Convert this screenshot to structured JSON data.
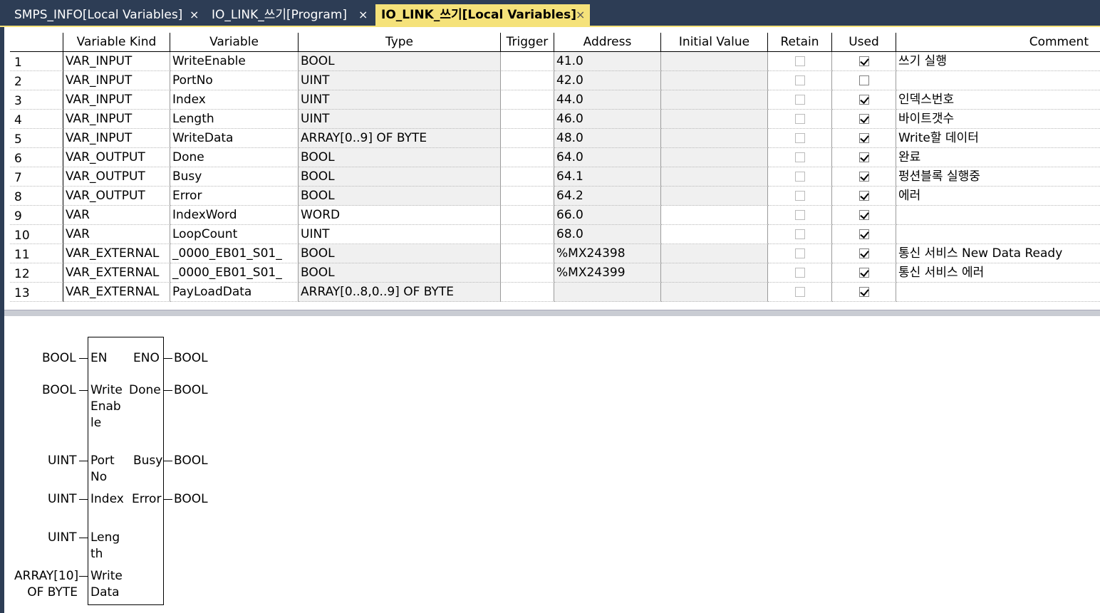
{
  "tabs": [
    {
      "label": "SMPS_INFO[Local Variables]",
      "close": "×",
      "active": false
    },
    {
      "label": "IO_LINK_쓰기[Program]",
      "close": "×",
      "active": false
    },
    {
      "label": "IO_LINK_쓰기[Local Variables]",
      "close": "×",
      "active": true
    }
  ],
  "grid": {
    "columns": [
      "Variable Kind",
      "Variable",
      "Type",
      "Trigger",
      "Address",
      "Initial Value",
      "Retain",
      "Used",
      "Comment"
    ],
    "rows": [
      {
        "num": "1",
        "kind": "VAR_INPUT",
        "var": "WriteEnable",
        "type": "BOOL",
        "trigger": "",
        "address": "41.0",
        "init": "",
        "retain": false,
        "used": true,
        "comment": "쓰기 실행"
      },
      {
        "num": "2",
        "kind": "VAR_INPUT",
        "var": "PortNo",
        "type": "UINT",
        "trigger": "",
        "address": "42.0",
        "init": "",
        "retain": false,
        "used": false,
        "comment": ""
      },
      {
        "num": "3",
        "kind": "VAR_INPUT",
        "var": "Index",
        "type": "UINT",
        "trigger": "",
        "address": "44.0",
        "init": "",
        "retain": false,
        "used": true,
        "comment": "인덱스번호"
      },
      {
        "num": "4",
        "kind": "VAR_INPUT",
        "var": "Length",
        "type": "UINT",
        "trigger": "",
        "address": "46.0",
        "init": "",
        "retain": false,
        "used": true,
        "comment": "바이트갯수"
      },
      {
        "num": "5",
        "kind": "VAR_INPUT",
        "var": "WriteData",
        "type": "ARRAY[0..9] OF BYTE",
        "trigger": "",
        "address": "48.0",
        "init": "",
        "retain": false,
        "used": true,
        "comment": "Write할 데이터"
      },
      {
        "num": "6",
        "kind": "VAR_OUTPUT",
        "var": "Done",
        "type": "BOOL",
        "trigger": "",
        "address": "64.0",
        "init": "",
        "retain": false,
        "used": true,
        "comment": "완료"
      },
      {
        "num": "7",
        "kind": "VAR_OUTPUT",
        "var": "Busy",
        "type": "BOOL",
        "trigger": "",
        "address": "64.1",
        "init": "",
        "retain": false,
        "used": true,
        "comment": "펑션블록 실행중"
      },
      {
        "num": "8",
        "kind": "VAR_OUTPUT",
        "var": "Error",
        "type": "BOOL",
        "trigger": "",
        "address": "64.2",
        "init": "",
        "retain": false,
        "used": true,
        "comment": "에러"
      },
      {
        "num": "9",
        "kind": "VAR",
        "var": "IndexWord",
        "type": "WORD",
        "trigger": "",
        "address": "66.0",
        "init": "",
        "retain": false,
        "used": true,
        "comment": ""
      },
      {
        "num": "10",
        "kind": "VAR",
        "var": "LoopCount",
        "type": "UINT",
        "trigger": "",
        "address": "68.0",
        "init": "",
        "retain": false,
        "used": true,
        "comment": ""
      },
      {
        "num": "11",
        "kind": "VAR_EXTERNAL",
        "var": "_0000_EB01_S01_",
        "type": "BOOL",
        "trigger": "",
        "address": "%MX24398",
        "init": "",
        "retain": false,
        "used": true,
        "comment": "통신 서비스 New Data Ready"
      },
      {
        "num": "12",
        "kind": "VAR_EXTERNAL",
        "var": "_0000_EB01_S01_",
        "type": "BOOL",
        "trigger": "",
        "address": "%MX24399",
        "init": "",
        "retain": false,
        "used": true,
        "comment": "통신 서비스 에러"
      },
      {
        "num": "13",
        "kind": "VAR_EXTERNAL",
        "var": "PayLoadData",
        "type": "ARRAY[0..8,0..9] OF BYTE",
        "trigger": "",
        "address": "",
        "init": "",
        "retain": false,
        "used": true,
        "comment": ""
      }
    ]
  },
  "function_block": {
    "inputs": [
      {
        "type": "BOOL",
        "name": "EN"
      },
      {
        "type": "BOOL",
        "name": "Write\nEnab\nle"
      },
      {
        "type": "UINT",
        "name": "Port\nNo"
      },
      {
        "type": "UINT",
        "name": "Index"
      },
      {
        "type": "UINT",
        "name": "Leng\nth"
      },
      {
        "type": "ARRAY[10]\nOF BYTE",
        "name": "Write\nData"
      }
    ],
    "outputs": [
      {
        "name": "ENO",
        "type": "BOOL"
      },
      {
        "name": "Done",
        "type": "BOOL"
      },
      {
        "name": "Busy",
        "type": "BOOL"
      },
      {
        "name": "Error",
        "type": "BOOL"
      }
    ]
  },
  "colors": {
    "tabbar": "#2d3d55",
    "active_tab": "#f5e27a",
    "gray_cell": "#f0f0f0"
  }
}
